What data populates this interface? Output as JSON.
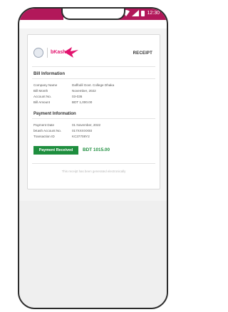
{
  "status": {
    "time": "12:30"
  },
  "receipt": {
    "title": "RECEIPT",
    "brand": "bKash",
    "bill_section": "Bill Information",
    "bill_rows": [
      {
        "label": "Company Name",
        "value": "Daffodil Govt. College Dhaka"
      },
      {
        "label": "Bill Month",
        "value": "November, 2022"
      },
      {
        "label": "Account No.",
        "value": "03-036"
      },
      {
        "label": "Bill Amount",
        "value": "BDT 1,000.00"
      }
    ],
    "payment_section": "Payment Information",
    "payment_rows": [
      {
        "label": "Payment Date",
        "value": "01 November, 2022"
      },
      {
        "label": "bKash Account No.",
        "value": "017XXXXX93"
      },
      {
        "label": "Transaction ID",
        "value": "KC37708Y2"
      }
    ],
    "payment_status": "Payment Received",
    "payment_amount": "BDT 1015.00",
    "footer": "This receipt has been generated electronically"
  },
  "colors": {
    "brand": "#e2136e",
    "status_bar": "#b2185a",
    "success": "#1e8e3e"
  }
}
